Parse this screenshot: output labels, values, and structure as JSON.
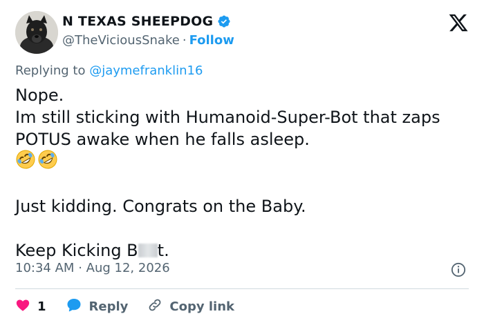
{
  "author": {
    "display_name": "N TEXAS SHEEPDOG",
    "handle": "@TheViciousSnake",
    "separator": "·",
    "follow_label": "Follow"
  },
  "reply_context": {
    "prefix": "Replying to",
    "mention": "@jaymefranklin16"
  },
  "tweet": {
    "line1": "Nope.",
    "line2": "Im still sticking with Humanoid-Super-Bot that zaps POTUS awake when he falls asleep.",
    "line3": "Just kidding. Congrats on the Baby.",
    "line4_before": "Keep Kicking B",
    "line4_after": "t.",
    "emoji": [
      "rolling-on-floor-laughing",
      "rolling-on-floor-laughing"
    ]
  },
  "meta": {
    "time": "10:34 AM",
    "separator": "·",
    "date": "Aug 12, 2026"
  },
  "actions": {
    "like_count": "1",
    "reply_label": "Reply",
    "copy_label": "Copy link"
  },
  "colors": {
    "accent": "#1d9bf0",
    "like": "#f91880",
    "muted": "#536471",
    "text": "#0f1419"
  }
}
